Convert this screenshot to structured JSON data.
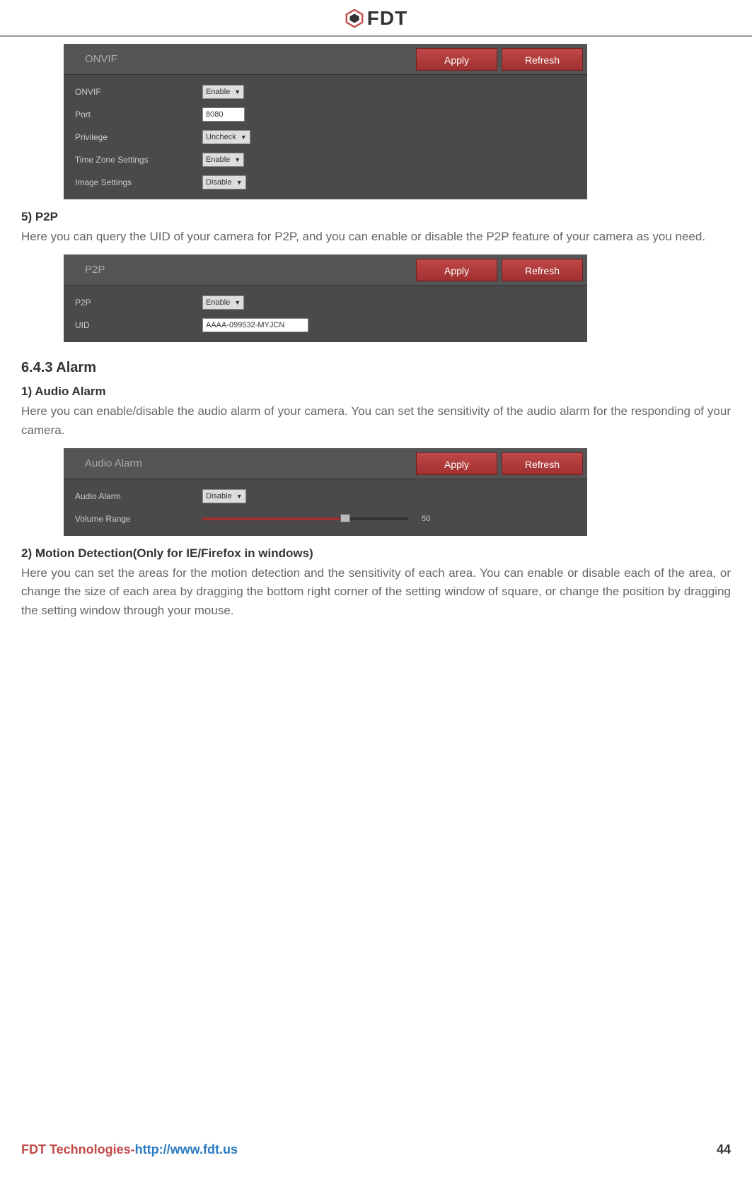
{
  "header": {
    "brand": "FDT"
  },
  "panels": {
    "onvif": {
      "title": "ONVIF",
      "apply": "Apply",
      "refresh": "Refresh",
      "rows": {
        "onvif_label": "ONVIF",
        "onvif_value": "Enable",
        "port_label": "Port",
        "port_value": "8080",
        "privilege_label": "Privilege",
        "privilege_value": "Uncheck",
        "timezone_label": "Time Zone Settings",
        "timezone_value": "Enable",
        "image_label": "Image Settings",
        "image_value": "Disable"
      }
    },
    "p2p": {
      "title": "P2P",
      "apply": "Apply",
      "refresh": "Refresh",
      "rows": {
        "p2p_label": "P2P",
        "p2p_value": "Enable",
        "uid_label": "UID",
        "uid_value": "AAAA-099532-MYJCN"
      }
    },
    "audio": {
      "title": "Audio Alarm",
      "apply": "Apply",
      "refresh": "Refresh",
      "rows": {
        "alarm_label": "Audio Alarm",
        "alarm_value": "Disable",
        "volume_label": "Volume Range",
        "volume_value": "50"
      }
    }
  },
  "doc": {
    "s5_heading": "5) P2P",
    "s5_text": "Here you can query the UID of your camera for P2P, and you can enable or disable the P2P feature of your camera as you need.",
    "h643": "6.4.3 Alarm",
    "s1_heading": "1) Audio Alarm",
    "s1_text": "Here you can enable/disable the audio alarm of your camera. You can set the sensitivity of the audio alarm for the responding of your camera.",
    "s2_heading": "2) Motion Detection(Only for IE/Firefox in windows)",
    "s2_text": "Here you can set the areas for the motion detection and the sensitivity of each area. You can enable or disable each of the area, or change the size of each area by dragging the bottom right corner of the setting window of square, or change the position by dragging the setting window through your mouse."
  },
  "footer": {
    "company": "FDT Technologies-",
    "url": "http://www.fdt.us",
    "page": "44"
  }
}
